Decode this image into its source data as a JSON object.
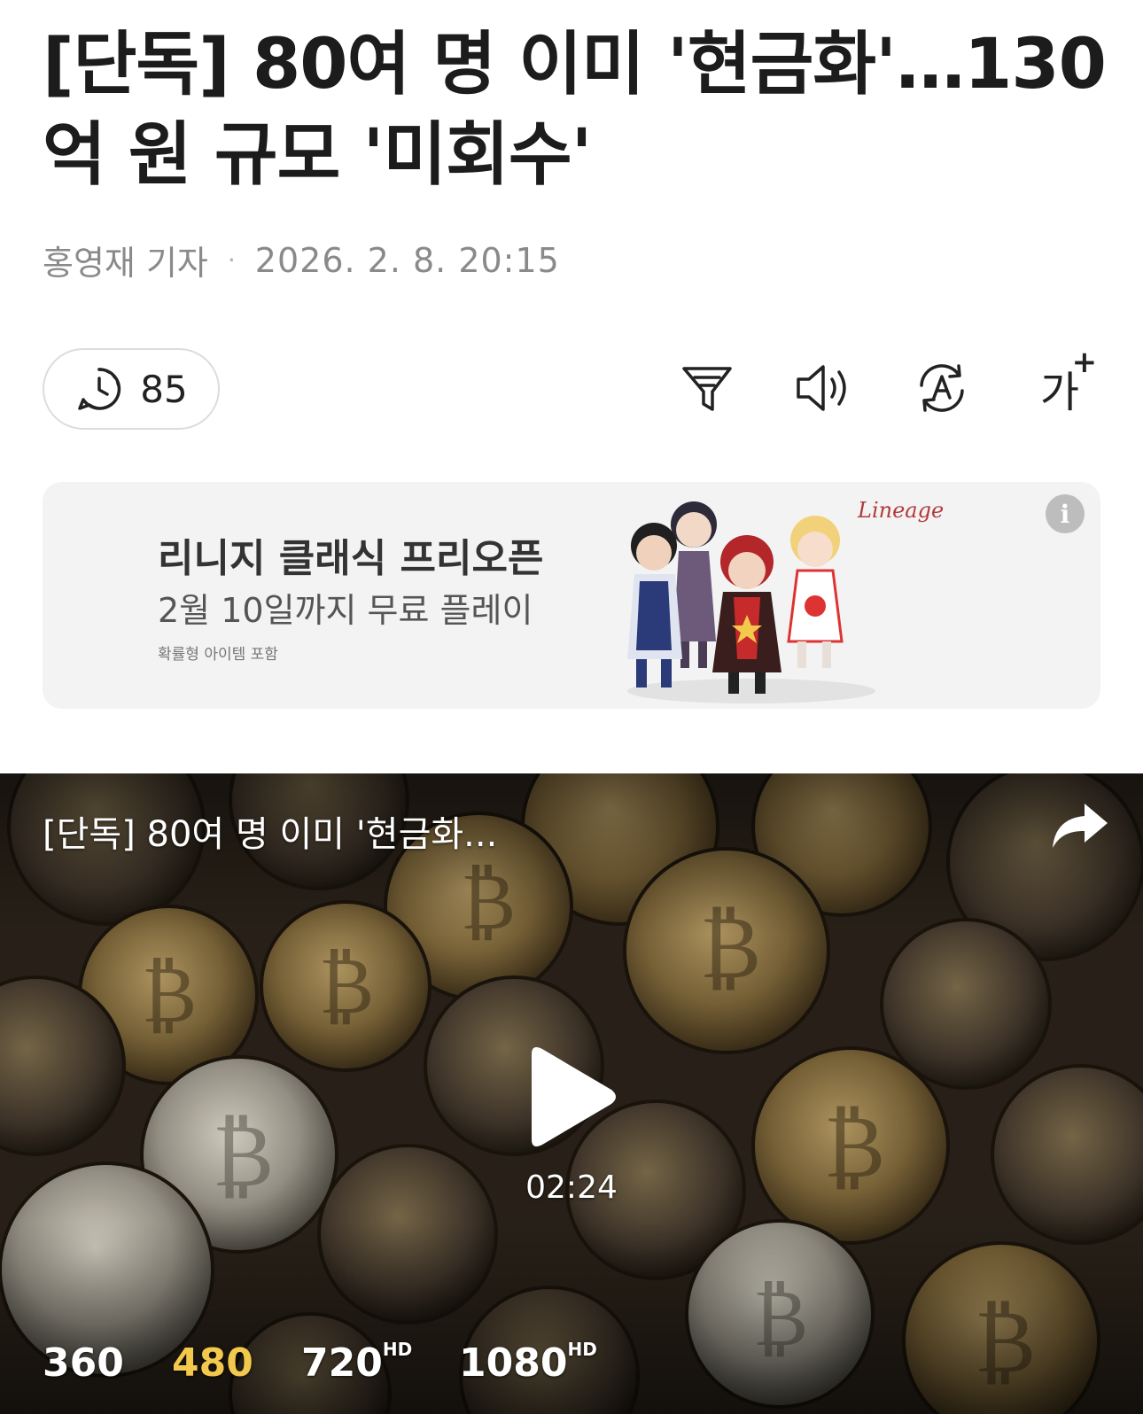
{
  "article": {
    "headline": "[단독] 80여 명 이미 '현금화'…130억 원 규모 '미회수'",
    "reporter": "홍영재 기자",
    "separator": "·",
    "datetime": "2026. 2. 8. 20:15"
  },
  "toolbar": {
    "comment_count": "85",
    "font_size_label": "가",
    "font_size_plus": "+",
    "icons": [
      "comment-clock-icon",
      "summary-filter-icon",
      "speaker-icon",
      "translate-icon",
      "font-size-icon"
    ]
  },
  "ad": {
    "title": "리니지 클래식 프리오픈",
    "subtitle": "2월 10일까지 무료 플레이",
    "note": "확률형 아이템 포함",
    "info": "i",
    "logo": "Lineage"
  },
  "video": {
    "title": "[단독] 80여 명 이미 '현금화...",
    "duration": "02:24",
    "qualities": [
      {
        "label": "360",
        "hd": ""
      },
      {
        "label": "480",
        "hd": "",
        "active": true
      },
      {
        "label": "720",
        "hd": "HD"
      },
      {
        "label": "1080",
        "hd": "HD"
      }
    ],
    "accent": "#f2c94c"
  }
}
